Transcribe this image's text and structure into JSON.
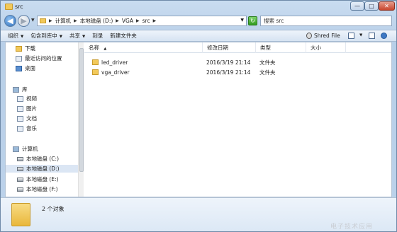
{
  "window": {
    "title": "src",
    "min_btn": "—",
    "max_btn": "□",
    "close_btn": "✕"
  },
  "nav": {
    "back": "◀",
    "forward": "▶",
    "history_dropdown": "▼",
    "breadcrumb": [
      "计算机",
      "本地磁盘 (D:)",
      "VGA",
      "src"
    ],
    "address_dropdown": "▼",
    "refresh": "↻",
    "search_placeholder": "搜索 src"
  },
  "toolbar": {
    "organize": "组织",
    "include": "包含到库中",
    "share": "共享",
    "burn": "刻录",
    "new_folder": "新建文件夹",
    "dropdown_arrow": "▼",
    "shred": "Shred File"
  },
  "sidebar": {
    "favorites": [
      "下载",
      "最近访问的位置",
      "桌面"
    ],
    "library_header": "库",
    "libraries": [
      "视频",
      "图片",
      "文档",
      "音乐"
    ],
    "computer_header": "计算机",
    "drives": [
      "本地磁盘 (C:)",
      "本地磁盘 (D:)",
      "本地磁盘 (E:)",
      "本地磁盘 (F:)"
    ]
  },
  "list": {
    "columns": [
      "名称",
      "修改日期",
      "类型",
      "大小"
    ],
    "sort_indicator": "▲",
    "rows": [
      {
        "name": "led_driver",
        "date": "2016/3/19 21:14",
        "type": "文件夹",
        "size": ""
      },
      {
        "name": "vga_driver",
        "date": "2016/3/19 21:14",
        "type": "文件夹",
        "size": ""
      }
    ]
  },
  "details": {
    "count": "2 个对象"
  },
  "watermark": "电子技术应用"
}
